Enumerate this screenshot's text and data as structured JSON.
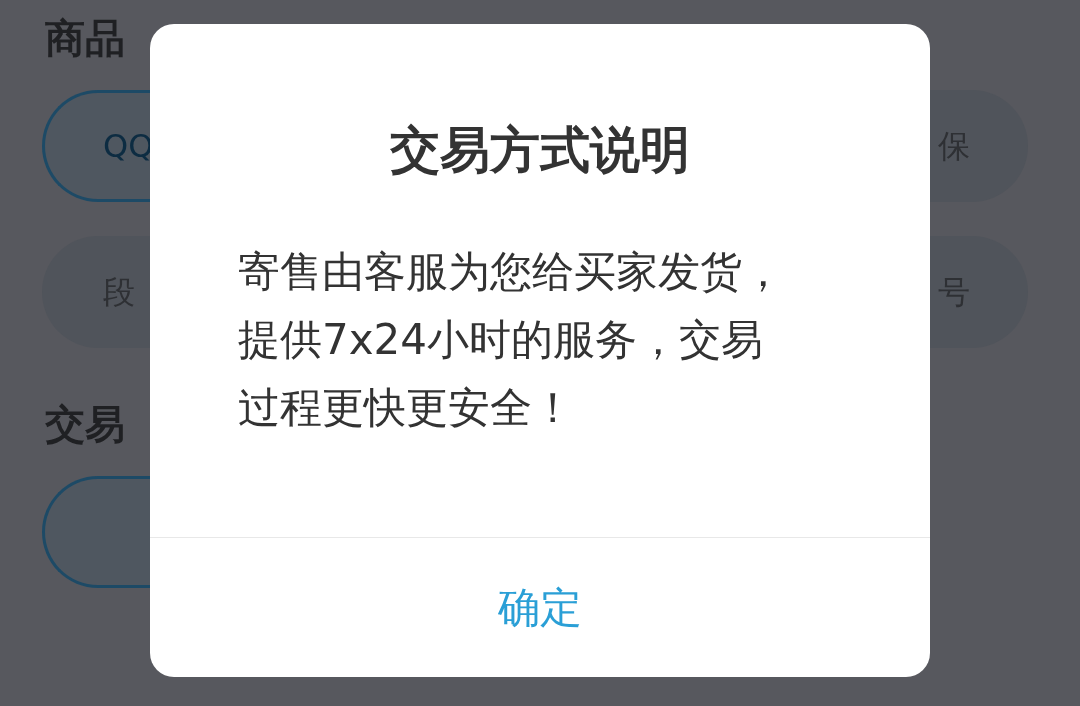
{
  "background": {
    "sections": [
      {
        "heading": "商品",
        "chips": [
          {
            "label": "QQ",
            "selected": true
          },
          {
            "label": "保",
            "selected": false
          }
        ]
      },
      {
        "chips": [
          {
            "label": "段",
            "selected": false
          },
          {
            "label": "号",
            "selected": false
          }
        ]
      },
      {
        "heading": "交易",
        "chips": [
          {
            "selected": true
          }
        ]
      }
    ]
  },
  "dialog": {
    "title": "交易方式说明",
    "message": "寄售由客服为您给买家发货，提供7x24小时的服务，交易过程更快更安全！",
    "button": "确定"
  }
}
